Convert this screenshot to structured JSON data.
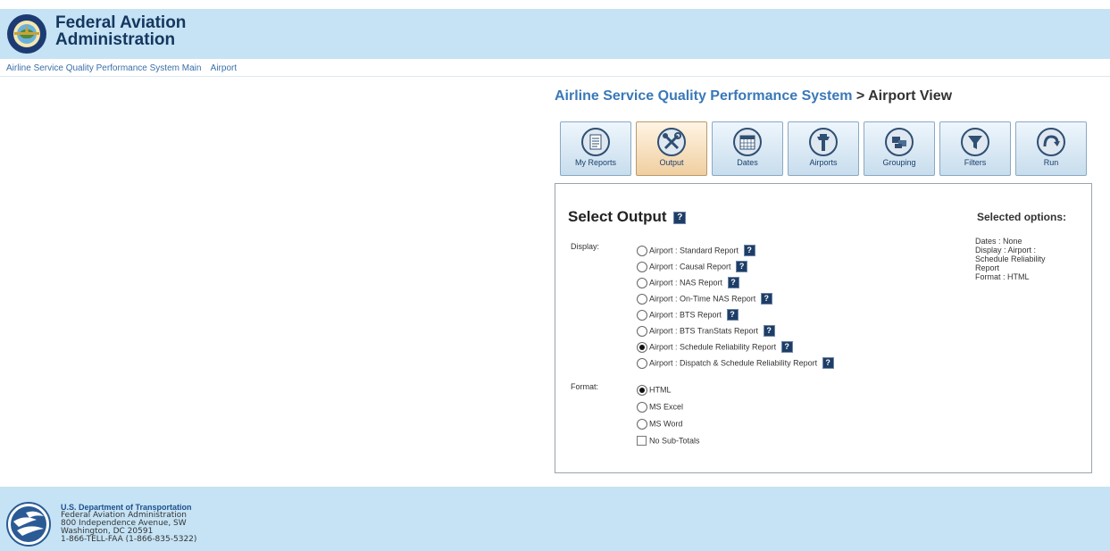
{
  "header": {
    "agency_line1": "Federal Aviation",
    "agency_line2": "Administration",
    "seal_icon": "faa-seal-icon",
    "seal_text": "FEDERAL AVIATION ADMINISTRATION"
  },
  "breadcrumb": [
    "Airline Service Quality Performance System Main",
    "Airport"
  ],
  "title": {
    "system": "Airline Service Quality Performance System",
    "separator_view": " > Airport View"
  },
  "toolbar": [
    {
      "label": "My Reports",
      "icon": "report-icon"
    },
    {
      "label": "Output",
      "icon": "tools-icon",
      "active": true
    },
    {
      "label": "Dates",
      "icon": "calendar-icon"
    },
    {
      "label": "Airports",
      "icon": "control-tower-icon"
    },
    {
      "label": "Grouping",
      "icon": "grouping-icon"
    },
    {
      "label": "Filters",
      "icon": "filter-icon"
    },
    {
      "label": "Run",
      "icon": "run-icon"
    }
  ],
  "panel": {
    "title": "Select Output",
    "display_label": "Display:",
    "format_label": "Format:",
    "help_glyph": "?",
    "display_options": [
      {
        "label": "Airport : Standard Report",
        "checked": false
      },
      {
        "label": "Airport : Causal Report",
        "checked": false
      },
      {
        "label": "Airport : NAS Report",
        "checked": false
      },
      {
        "label": "Airport : On-Time NAS Report",
        "checked": false
      },
      {
        "label": "Airport : BTS Report",
        "checked": false
      },
      {
        "label": "Airport : BTS TranStats Report",
        "checked": false
      },
      {
        "label": "Airport : Schedule Reliability Report",
        "checked": true
      },
      {
        "label": "Airport : Dispatch & Schedule Reliability Report",
        "checked": false
      }
    ],
    "format_options": [
      {
        "label": "HTML",
        "checked": true
      },
      {
        "label": "MS Excel",
        "checked": false
      },
      {
        "label": "MS Word",
        "checked": false
      }
    ],
    "subtotals_label": "No Sub-Totals",
    "subtotals_checked": false,
    "selected_heading": "Selected options:",
    "selected_lines": [
      "Dates : None",
      "Display : Airport : Schedule Reliability Report",
      "Format : HTML"
    ]
  },
  "footer": {
    "logo_icon": "dot-logo-icon",
    "dept": "U.S. Department of Transportation",
    "agency": "Federal Aviation Administration",
    "address1": "800 Independence Avenue, SW",
    "address2": "Washington, DC 20591",
    "phone": "1-866-TELL-FAA (1-866-835-5322)"
  },
  "colors": {
    "header_bg": "#c5e3f5",
    "link": "#3a6fa8",
    "title_accent": "#3a78b8",
    "active_tool": "#f0cfa0"
  }
}
